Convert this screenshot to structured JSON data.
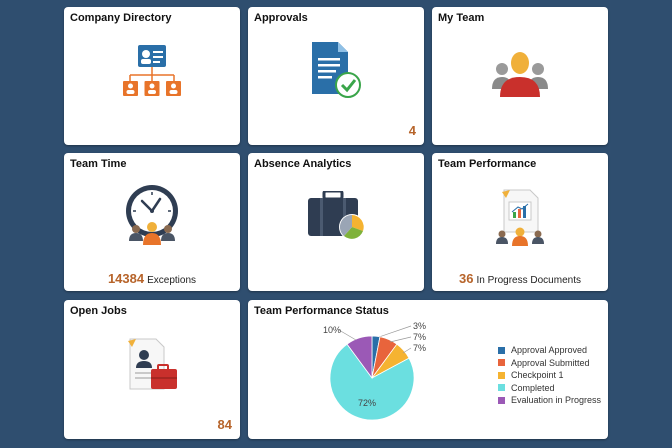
{
  "tiles": {
    "company_directory": {
      "title": "Company Directory"
    },
    "approvals": {
      "title": "Approvals",
      "count": "4"
    },
    "my_team": {
      "title": "My Team"
    },
    "team_time": {
      "title": "Team Time",
      "kpi_value": "14384",
      "kpi_label": "Exceptions"
    },
    "absence_analytics": {
      "title": "Absence Analytics"
    },
    "team_performance": {
      "title": "Team Performance",
      "kpi_value": "36",
      "kpi_label": "In Progress Documents"
    },
    "open_jobs": {
      "title": "Open Jobs",
      "count": "84"
    },
    "team_performance_status": {
      "title": "Team Performance Status"
    }
  },
  "chart_data": {
    "type": "pie",
    "title": "",
    "slices": [
      {
        "name": "Approval Approved",
        "value": 3,
        "label": "3%",
        "color": "#2a6fa8"
      },
      {
        "name": "Approval Submitted",
        "value": 7,
        "label": "7%",
        "color": "#e8643c"
      },
      {
        "name": "Checkpoint 1",
        "value": 7,
        "label": "7%",
        "color": "#f5b331"
      },
      {
        "name": "Completed",
        "value": 72,
        "label": "72%",
        "color": "#6bdfe0"
      },
      {
        "name": "Evaluation in Progress",
        "value": 10,
        "label": "10%",
        "color": "#9b59b6"
      }
    ],
    "legend_position": "right"
  },
  "colors": {
    "background": "#2f4e6f",
    "accent_count": "#b7642a"
  }
}
